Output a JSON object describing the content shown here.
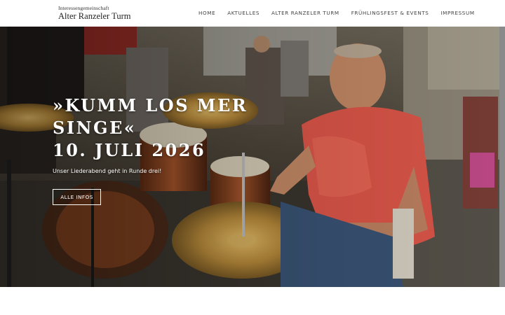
{
  "header": {
    "logo_small": "Interessengemeinschaft",
    "logo_big": "Alter Ranzeler Turm",
    "nav": [
      "HOME",
      "AKTUELLES",
      "ALTER RANZELER TURM",
      "FRÜHLINGSFEST & EVENTS",
      "IMPRESSUM"
    ]
  },
  "hero": {
    "title_line1": "»KUMM LOS MER",
    "title_line2": "SINGE«",
    "title_line3": "10. JULI 2026",
    "subtitle": "Unser Liederabend geht in Runde drei!",
    "button_label": "ALLE INFOS"
  },
  "colors": {
    "header_bg": "#ffffff",
    "hero_text": "#ffffff",
    "shirt": "#e0574a"
  }
}
